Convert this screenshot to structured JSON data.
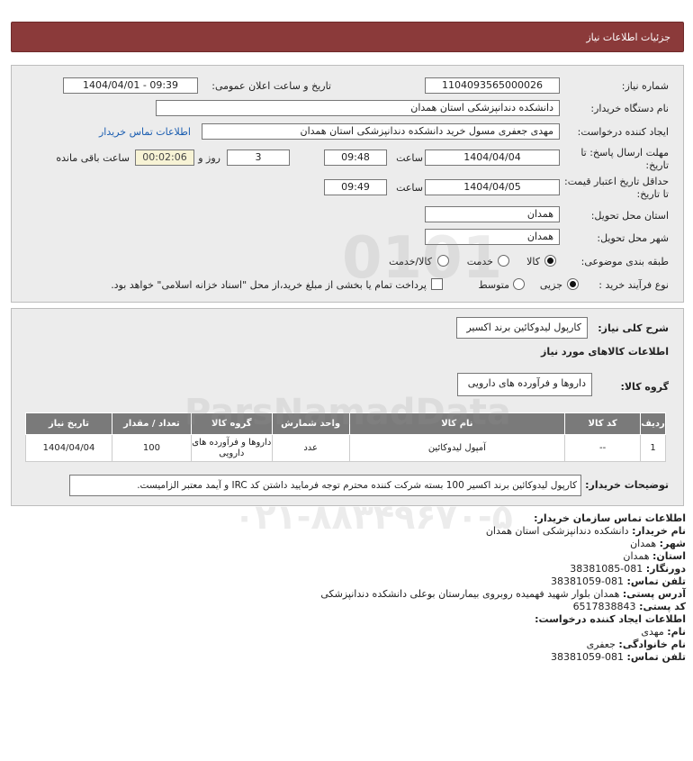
{
  "header": {
    "title": "جزئیات اطلاعات نیاز"
  },
  "form": {
    "need_number_label": "شماره نیاز:",
    "need_number": "1104093565000026",
    "announce_label": "تاریخ و ساعت اعلان عمومی:",
    "announce_value": "1404/04/01 - 09:39",
    "buyer_org_label": "نام دستگاه خریدار:",
    "buyer_org": "دانشکده دندانپزشکی استان همدان",
    "requester_label": "ایجاد کننده درخواست:",
    "requester": "مهدی جعفری مسول خرید دانشکده دندانپزشکی استان همدان",
    "contact_link": "اطلاعات تماس خریدار",
    "deadline_label": "مهلت ارسال پاسخ: تا تاریخ:",
    "deadline_date": "1404/04/04",
    "time_label": "ساعت",
    "deadline_time": "09:48",
    "days_value": "3",
    "days_label": "روز و",
    "remaining_time": "00:02:06",
    "remaining_label": "ساعت باقی مانده",
    "min_validity_label": "حداقل تاریخ اعتبار قیمت: تا تاریخ:",
    "validity_date": "1404/04/05",
    "validity_time": "09:49",
    "province_label": "استان محل تحویل:",
    "province": "همدان",
    "city_label": "شهر محل تحویل:",
    "city": "همدان",
    "category_label": "طبقه بندی موضوعی:",
    "category_options": [
      "کالا",
      "خدمت",
      "کالا/خدمت"
    ],
    "category_selected": "کالا",
    "process_label": "نوع فرآیند خرید :",
    "process_options": [
      "جزیی",
      "متوسط"
    ],
    "process_selected": "جزیی",
    "payment_note": "پرداخت تمام یا بخشی از مبلغ خرید،از محل \"اسناد خزانه اسلامی\" خواهد بود."
  },
  "details": {
    "summary_label": "شرح کلی نیاز:",
    "summary": "کارپول لیدوکائین برند اکسیر",
    "goods_info_title": "اطلاعات کالاهای مورد نیاز",
    "goods_group_label": "گروه کالا:",
    "goods_group": "داروها و فرآورده های دارویی",
    "table": {
      "headers": [
        "ردیف",
        "کد کالا",
        "نام کالا",
        "واحد شمارش",
        "گروه کالا",
        "تعداد / مقدار",
        "تاریخ نیاز"
      ],
      "rows": [
        [
          "1",
          "--",
          "آمپول لیدوکائین",
          "عدد",
          "داروها و فرآورده های دارویی",
          "100",
          "1404/04/04"
        ]
      ]
    },
    "buyer_notes_label": "توضیحات خریدار:",
    "buyer_notes": "کارپول لیدوکائین برند اکسیر 100 بسته شرکت کننده محترم توجه فرمایید داشتن کد IRC و آیمد معتبر الزامیست."
  },
  "contact": {
    "title": "اطلاعات تماس سازمان خریدار:",
    "buyer_name_label": "نام خریدار:",
    "buyer_name": "دانشکده دندانپزشکی استان همدان",
    "city_label": "شهر:",
    "city": "همدان",
    "province_label": "استان:",
    "province": "همدان",
    "fax_label": "دورنگار:",
    "fax": "081-38381085",
    "phone_label": "تلفن تماس:",
    "phone": "081-38381059",
    "address_label": "آدرس پستی:",
    "address": "همدان بلوار شهید فهمیده روبروی بیمارستان بوعلی دانشکده دندانپزشکی",
    "postal_label": "کد پستی:",
    "postal": "6517838843",
    "creator_title": "اطلاعات ایجاد کننده درخواست:",
    "first_name_label": "نام:",
    "first_name": "مهدی",
    "last_name_label": "نام خانوادگی:",
    "last_name": "جعفری",
    "creator_phone_label": "تلفن تماس:",
    "creator_phone": "081-38381059"
  },
  "colors": {
    "header_bg": "#8b3a3a",
    "panel_bg": "#ececec",
    "table_header_bg": "#7a7a7a",
    "link": "#1a5db0",
    "timer_bg": "#f7f3d5"
  }
}
